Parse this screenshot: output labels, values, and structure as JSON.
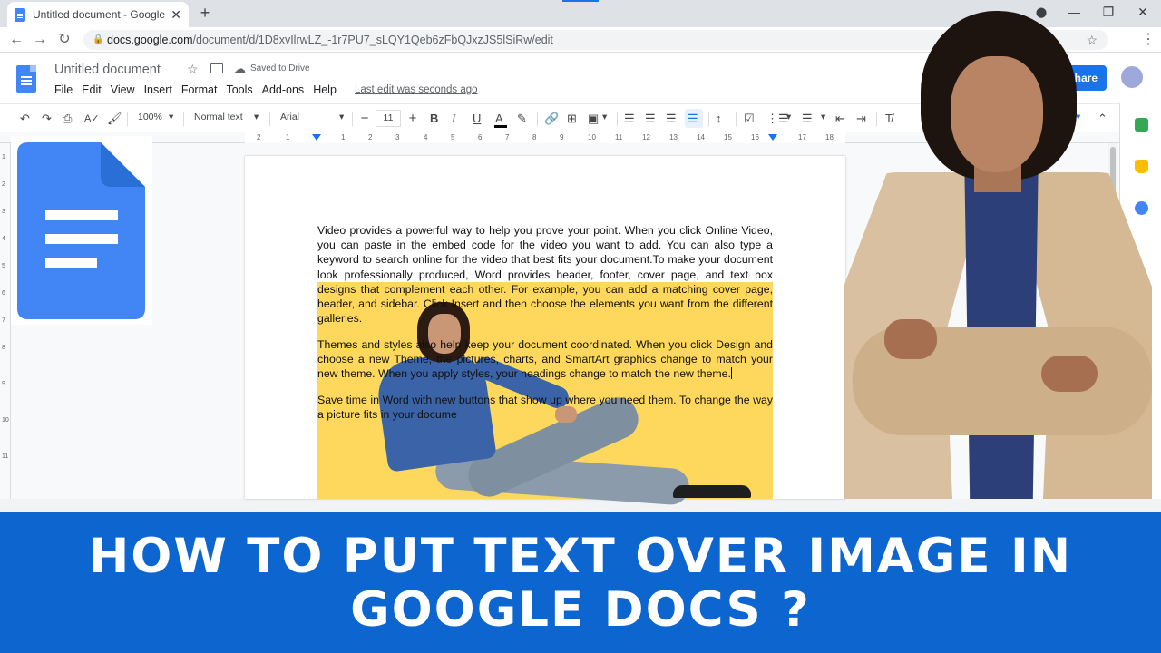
{
  "browser": {
    "tab_title": "Untitled document - Google Docs",
    "tab_close": "✕",
    "new_tab": "+",
    "url_host": "docs.google.com",
    "url_path": "/document/d/1D8xvIlrwLZ_-1r7PU7_sLQY1Qeb6zFbQJxzJS5lSiRw/edit"
  },
  "docs": {
    "title": "Untitled document",
    "saved_status": "Saved to Drive",
    "menu": [
      "File",
      "Edit",
      "View",
      "Insert",
      "Format",
      "Tools",
      "Add-ons",
      "Help"
    ],
    "last_edit": "Last edit was seconds ago",
    "share_label": "Share"
  },
  "toolbar": {
    "zoom": "100%",
    "style": "Normal text",
    "font": "Arial",
    "font_size": "11"
  },
  "ruler": {
    "numbers": [
      "2",
      "1",
      "1",
      "2",
      "3",
      "4",
      "5",
      "6",
      "7",
      "8",
      "9",
      "10",
      "11",
      "12",
      "13",
      "14",
      "15",
      "16",
      "17",
      "18"
    ]
  },
  "vruler": {
    "numbers": [
      "1",
      "2",
      "3",
      "4",
      "5",
      "6",
      "7",
      "8",
      "9",
      "10",
      "11"
    ]
  },
  "document": {
    "paragraph1": "Video provides a powerful way to help you prove your point. When you click Online Video, you can paste in the embed code for the video you want to add. You can also type a keyword to search online for the video that best fits your document.To make your document look professionally produced, Word provides header, footer, cover page, and text box designs that complement each other. For example, you can add a matching cover page, header, and sidebar. Click Insert and then choose the elements you want from the different galleries.",
    "paragraph2": "Themes and styles also help keep your document coordinated. When you click Design and choose a new Theme, the pictures, charts, and SmartArt graphics change to match your new theme. When you apply styles, your headings change to match the new theme.",
    "paragraph3": "Save time in Word with new buttons that show up where you need them. To change the way a picture fits in your docume"
  },
  "banner": {
    "text": "HOW TO PUT TEXT OVER IMAGE IN GOOGLE DOCS ?"
  },
  "colors": {
    "banner_bg": "#0d66d0",
    "docs_blue": "#4285f4",
    "share_blue": "#1a73e8",
    "highlight_yellow": "#fdd85d"
  }
}
